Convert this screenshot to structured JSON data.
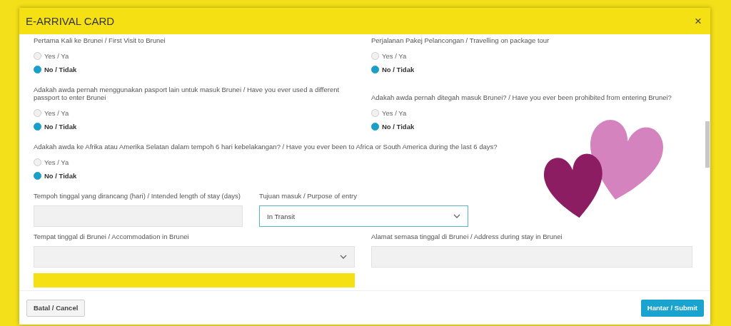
{
  "dialog": {
    "title": "E-ARRIVAL CARD",
    "close": "×"
  },
  "question_rows": [
    [
      {
        "label": "Pertama Kali ke Brunei / First Visit to Brunei",
        "options": [
          {
            "label": "Yes / Ya",
            "selected": false
          },
          {
            "label": "No / Tidak",
            "selected": true
          }
        ]
      },
      {
        "label": "Perjalanan Pakej Pelancongan / Travelling on package tour",
        "options": [
          {
            "label": "Yes / Ya",
            "selected": false
          },
          {
            "label": "No / Tidak",
            "selected": true
          }
        ]
      }
    ],
    [
      {
        "label": "Adakah awda pernah menggunakan pasport lain untuk masuk Brunei / Have you ever used a different passport to enter Brunei",
        "options": [
          {
            "label": "Yes / Ya",
            "selected": false
          },
          {
            "label": "No / Tidak",
            "selected": true
          }
        ]
      },
      {
        "label": "Adakah awda pernah ditegah masuk Brunei? / Have you ever been prohibited from entering Brunei?",
        "options": [
          {
            "label": "Yes / Ya",
            "selected": false
          },
          {
            "label": "No / Tidak",
            "selected": true
          }
        ]
      }
    ],
    [
      {
        "label": "Adakah awda ke Afrika atau Amerika Selatan dalam tempoh 6 hari kebelakangan? / Have you ever been to Africa or South America during the last 6 days?",
        "options": [
          {
            "label": "Yes / Ya",
            "selected": false
          },
          {
            "label": "No / Tidak",
            "selected": true
          }
        ]
      }
    ]
  ],
  "field_rows": [
    [
      {
        "kind": "text",
        "label": "Tempoh tinggal yang dirancang (hari) / Intended length of stay (days)",
        "focused": false
      },
      {
        "kind": "select",
        "label": "Tujuan masuk / Purpose of entry",
        "value": "In Transit",
        "focused": true
      }
    ],
    [
      {
        "kind": "select",
        "label": "Tempat tinggal di Brunei / Accommodation in Brunei",
        "focused": false
      },
      {
        "kind": "text",
        "label": "Alamat semasa tinggal di Brunei / Address during stay in Brunei",
        "focused": false
      }
    ]
  ],
  "footer": {
    "cancel": "Batal / Cancel",
    "submit": "Hantar / Submit"
  }
}
